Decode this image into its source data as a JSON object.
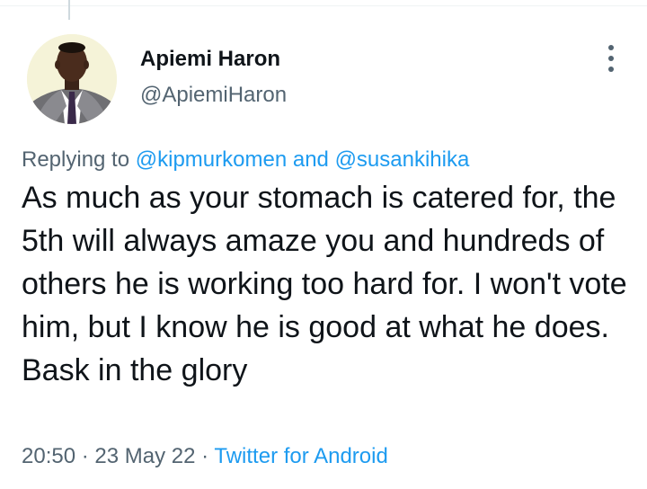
{
  "tweet": {
    "author_name": "Apiemi Haron",
    "author_handle": "@ApiemiHaron",
    "replying_prefix": "Replying to",
    "replying_user_1": "@kipmurkomen",
    "replying_and": "and",
    "replying_user_2": "@susankihika",
    "text": "As much as your stomach is catered for, the 5th will always amaze you and hundreds of others he is working too hard for. I won't vote him, but I know he is good at what he does. Bask in the glory",
    "time": "20:50",
    "separator": "·",
    "date": "23 May 22",
    "source": "Twitter for Android"
  },
  "icons": {
    "more": "more-vertical-icon"
  },
  "colors": {
    "text_primary": "#0f1419",
    "text_secondary": "#536471",
    "link": "#1d9bf0",
    "divider": "#eff3f4"
  }
}
